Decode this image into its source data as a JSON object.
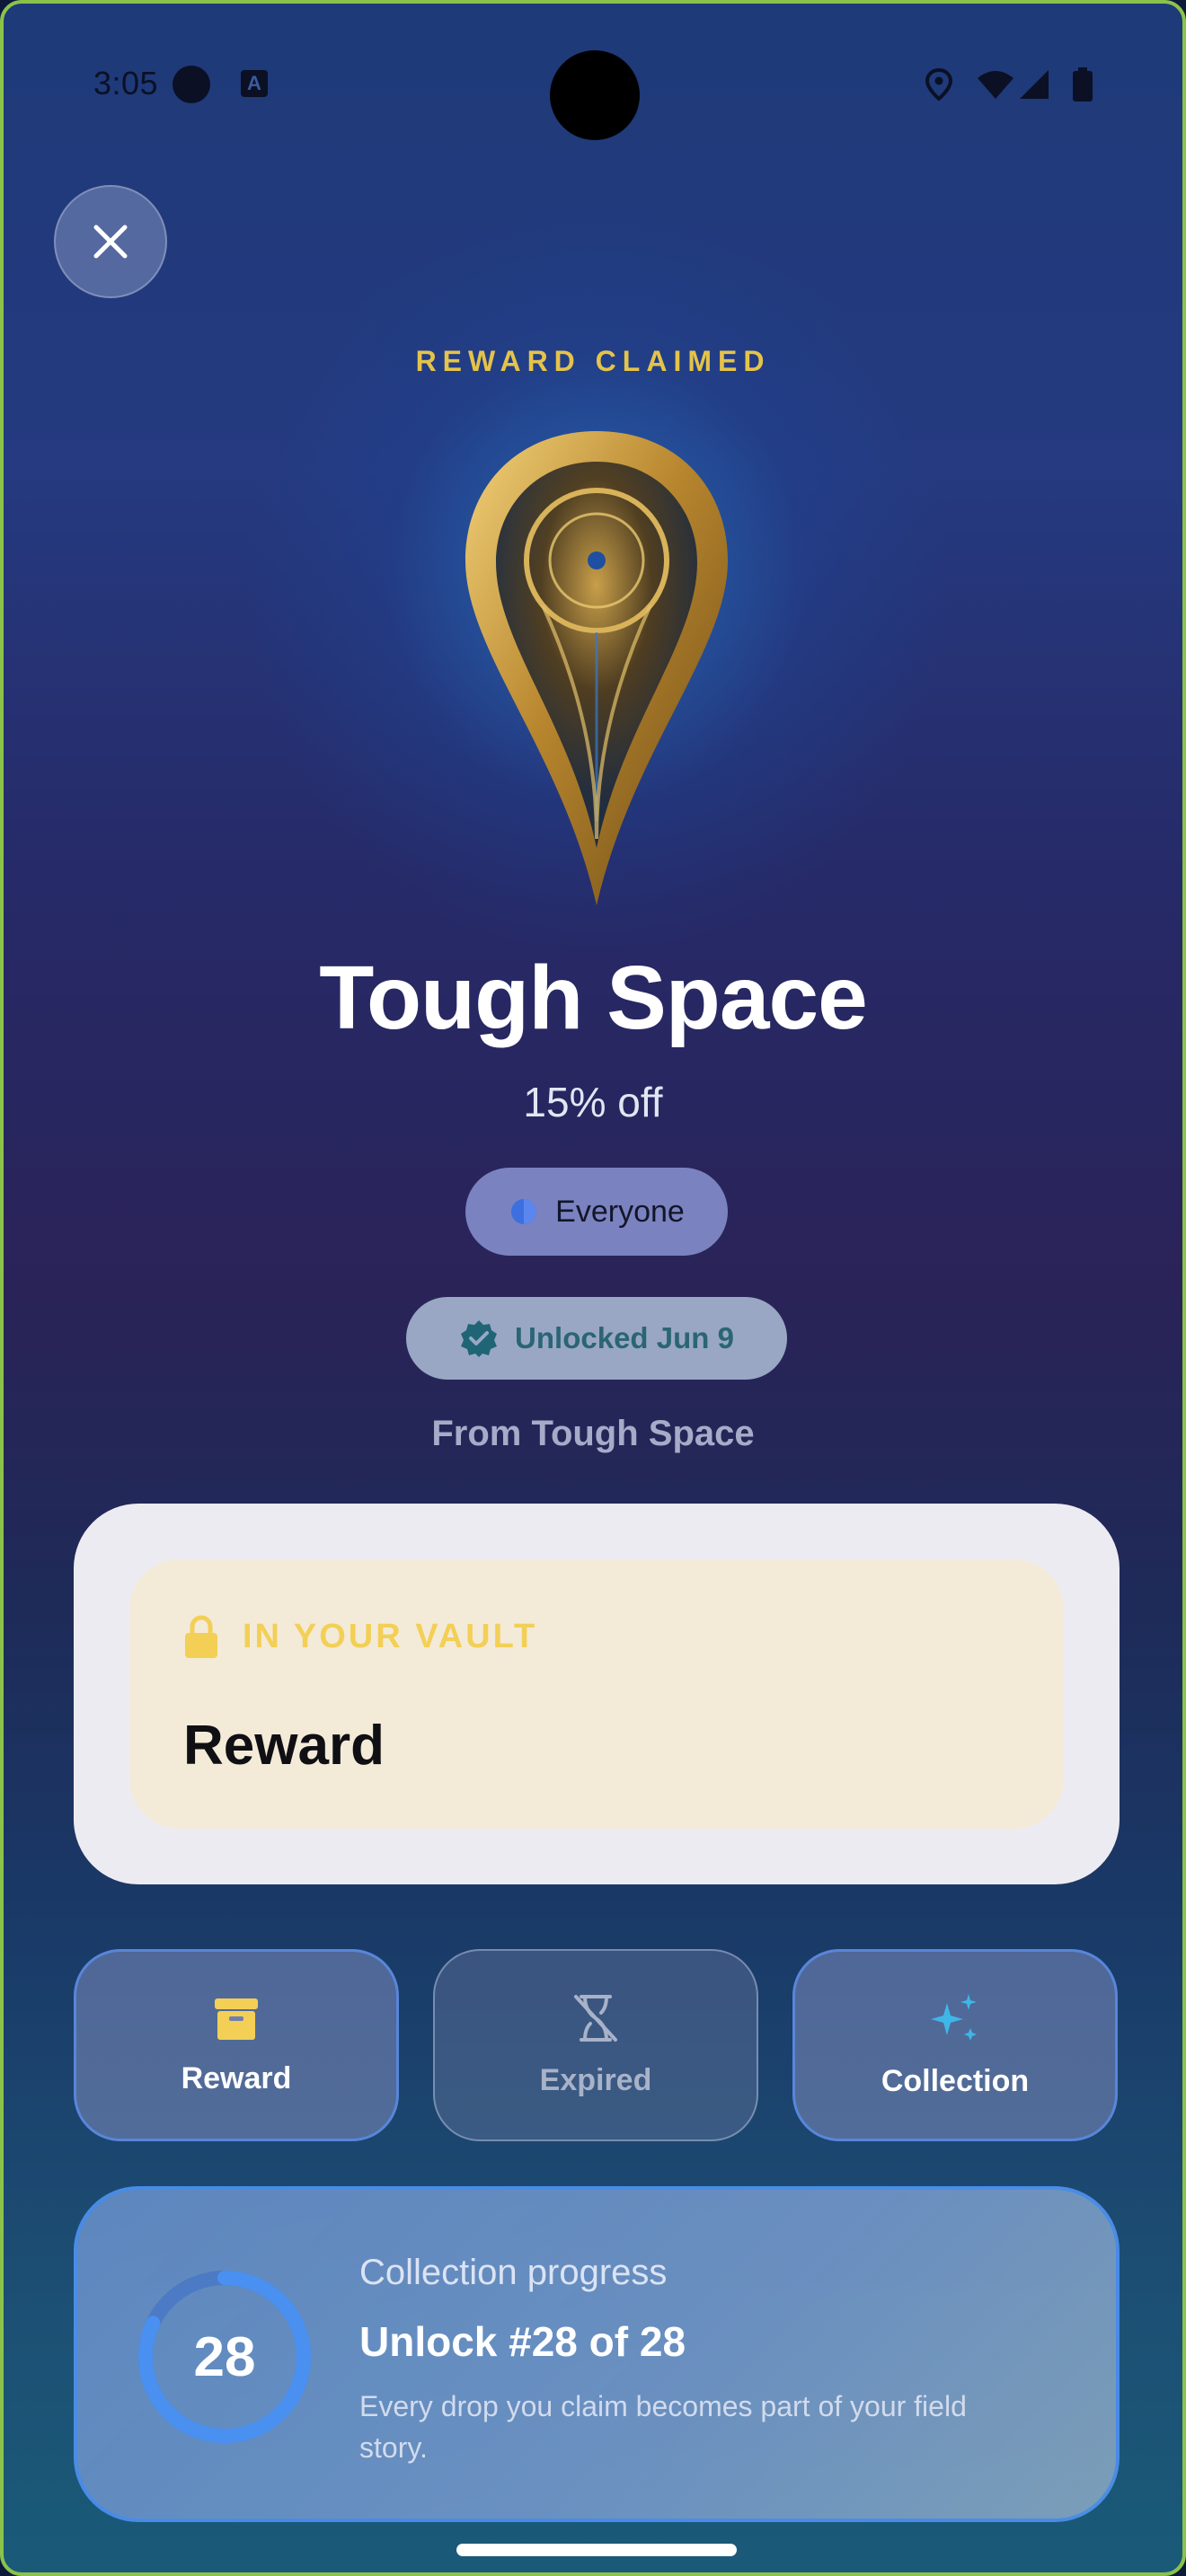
{
  "status_bar": {
    "time": "3:05",
    "icons": [
      "notification-dot",
      "app-icon",
      "location-icon",
      "wifi-icon",
      "signal-icon",
      "battery-icon"
    ]
  },
  "header": {
    "claimed_label": "REWARD CLAIMED",
    "close_icon": "close-icon"
  },
  "reward": {
    "title": "Tough Space",
    "offer": "15% off",
    "audience_chip": "Everyone",
    "unlocked_chip": "Unlocked Jun 9",
    "from": "From Tough Space"
  },
  "vault": {
    "label": "IN YOUR VAULT",
    "title": "Reward"
  },
  "tiles": [
    {
      "label": "Reward",
      "icon": "archive-box-icon"
    },
    {
      "label": "Expired",
      "icon": "hourglass-off-icon"
    },
    {
      "label": "Collection",
      "icon": "sparkle-icon"
    }
  ],
  "progress": {
    "label": "Collection progress",
    "title": "Unlock #28 of 28",
    "count": "28",
    "fraction": 0.82,
    "description": "Every drop you claim becomes part of your field story."
  },
  "colors": {
    "accent_gold": "#e5c34a",
    "vault_gold": "#f3cf56",
    "border_blue": "#468ceb",
    "ring_blue": "#4a90f0"
  }
}
